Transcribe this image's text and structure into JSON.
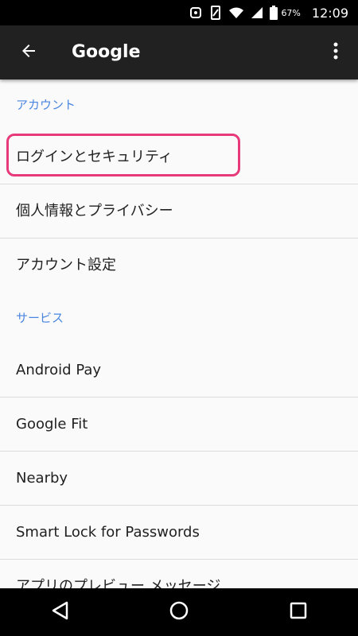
{
  "status_bar": {
    "icons": [
      "notification-icon",
      "vibrate-icon",
      "wifi-icon",
      "signal-icon",
      "battery-icon"
    ],
    "battery_percent": "67%",
    "time": "12:09"
  },
  "app_bar": {
    "title": "Google",
    "background": "#212121"
  },
  "sections": {
    "account_header": "アカウント",
    "services_header": "サービス"
  },
  "items": {
    "login_security": "ログインとセキュリティ",
    "personal_info": "個人情報とプライバシー",
    "account_settings": "アカウント設定",
    "android_pay": "Android Pay",
    "google_fit": "Google Fit",
    "nearby": "Nearby",
    "smart_lock": "Smart Lock for Passwords",
    "app_preview": "アプリのプレビュー メッセージ"
  },
  "colors": {
    "section_header": "#4a86e0",
    "highlight": "#e73a7a"
  }
}
